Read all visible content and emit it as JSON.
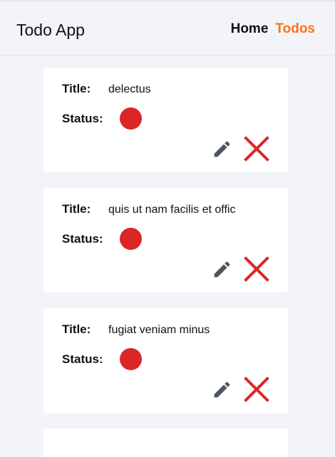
{
  "header": {
    "app_title": "Todo App",
    "nav": {
      "home_label": "Home",
      "todos_label": "Todos"
    }
  },
  "labels": {
    "title": "Title:",
    "status": "Status:"
  },
  "colors": {
    "active_nav": "#f97316",
    "status_incomplete": "#dc2626",
    "edit_icon": "#4b5563",
    "delete_icon": "#dc2626"
  },
  "todos": [
    {
      "title": "delectus",
      "status": "incomplete",
      "status_color": "#dc2626",
      "edit_icon": "pencil-icon",
      "delete_icon": "close-icon"
    },
    {
      "title": "quis ut nam facilis et offic",
      "status": "incomplete",
      "status_color": "#dc2626",
      "edit_icon": "pencil-icon",
      "delete_icon": "close-icon"
    },
    {
      "title": "fugiat veniam minus",
      "status": "incomplete",
      "status_color": "#dc2626",
      "edit_icon": "pencil-icon",
      "delete_icon": "close-icon"
    }
  ]
}
